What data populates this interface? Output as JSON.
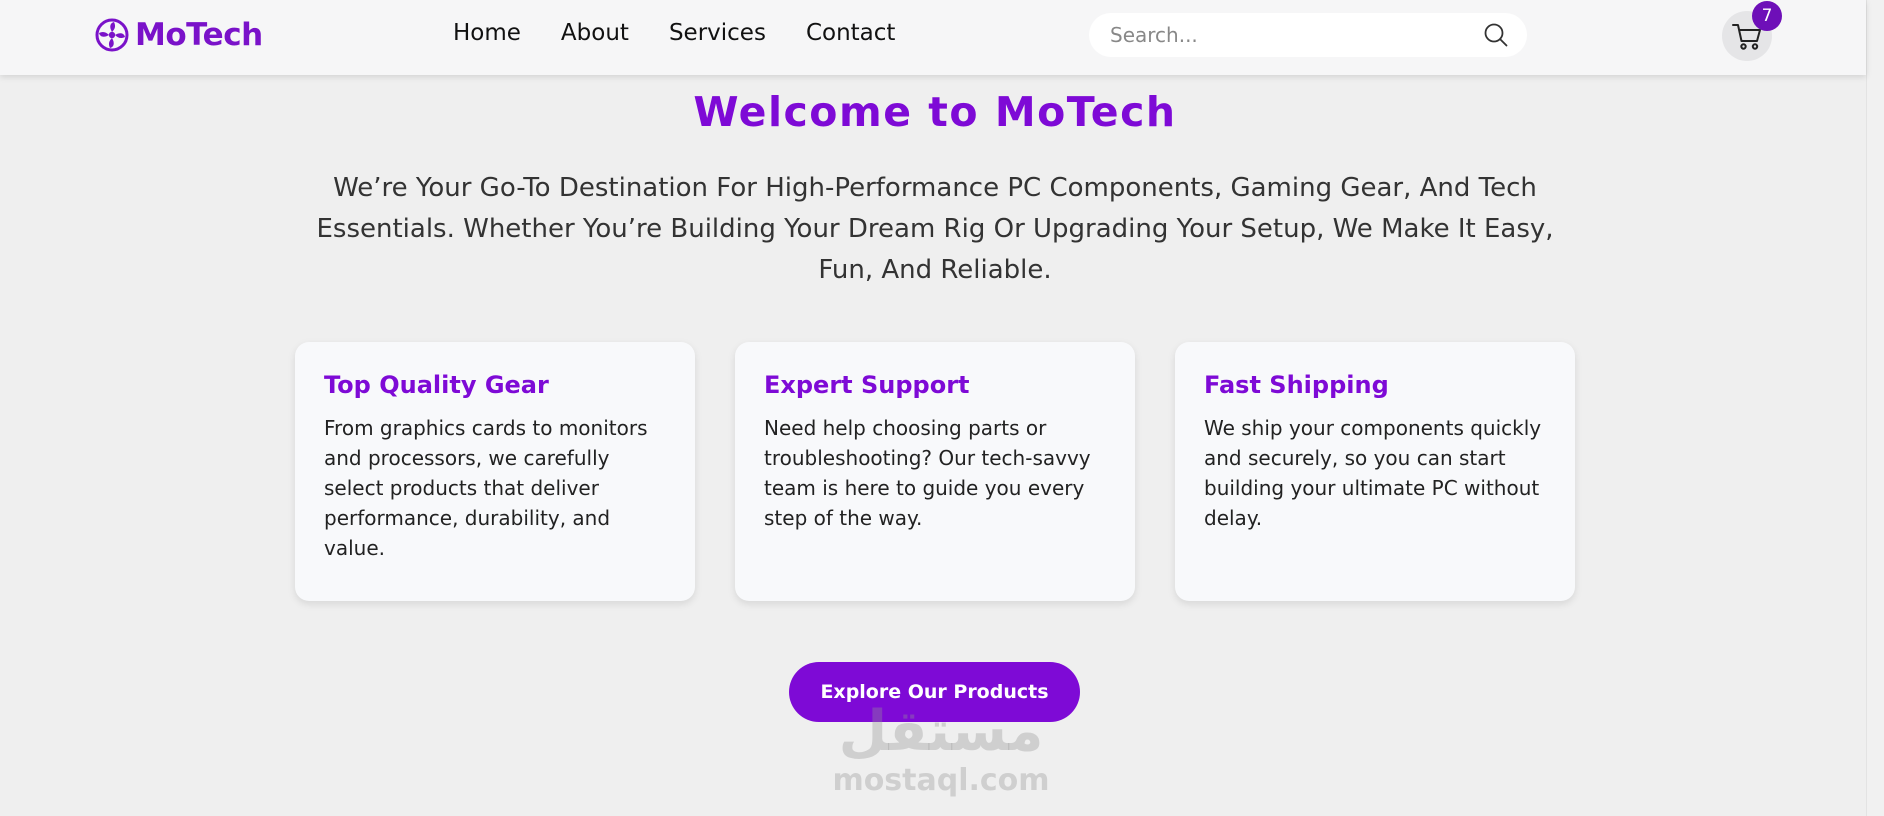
{
  "header": {
    "brand_name": "MoTech",
    "nav": [
      {
        "label": "Home"
      },
      {
        "label": "About"
      },
      {
        "label": "Services"
      },
      {
        "label": "Contact"
      }
    ],
    "search": {
      "placeholder": "Search...",
      "value": ""
    },
    "cart": {
      "count": "7"
    }
  },
  "hero": {
    "title": "Welcome to MoTech",
    "text": "We’re Your Go-To Destination For High-Performance PC Components, Gaming Gear, And Tech Essentials. Whether You’re Building Your Dream Rig Or Upgrading Your Setup, We Make It Easy, Fun, And Reliable."
  },
  "features": [
    {
      "title": "Top Quality Gear",
      "text": "From graphics cards to monitors and processors, we carefully select products that deliver performance, durability, and value."
    },
    {
      "title": "Expert Support",
      "text": "Need help choosing parts or troubleshooting? Our tech-savvy team is here to guide you every step of the way."
    },
    {
      "title": "Fast Shipping",
      "text": "We ship your components quickly and securely, so you can start building your ultimate PC without delay."
    }
  ],
  "cta": {
    "label": "Explore Our Products"
  },
  "watermark": {
    "arabic": "مستقل",
    "latin": "mostaql.com"
  },
  "icons": {
    "logo": "fan-logo-icon",
    "search": "search-icon",
    "cart": "shopping-cart-icon"
  },
  "colors": {
    "accent": "#7e0ad6",
    "badge": "#6e0fb8",
    "background": "#efefef",
    "header": "#f6f6f7",
    "card": "#f8f9fb"
  }
}
